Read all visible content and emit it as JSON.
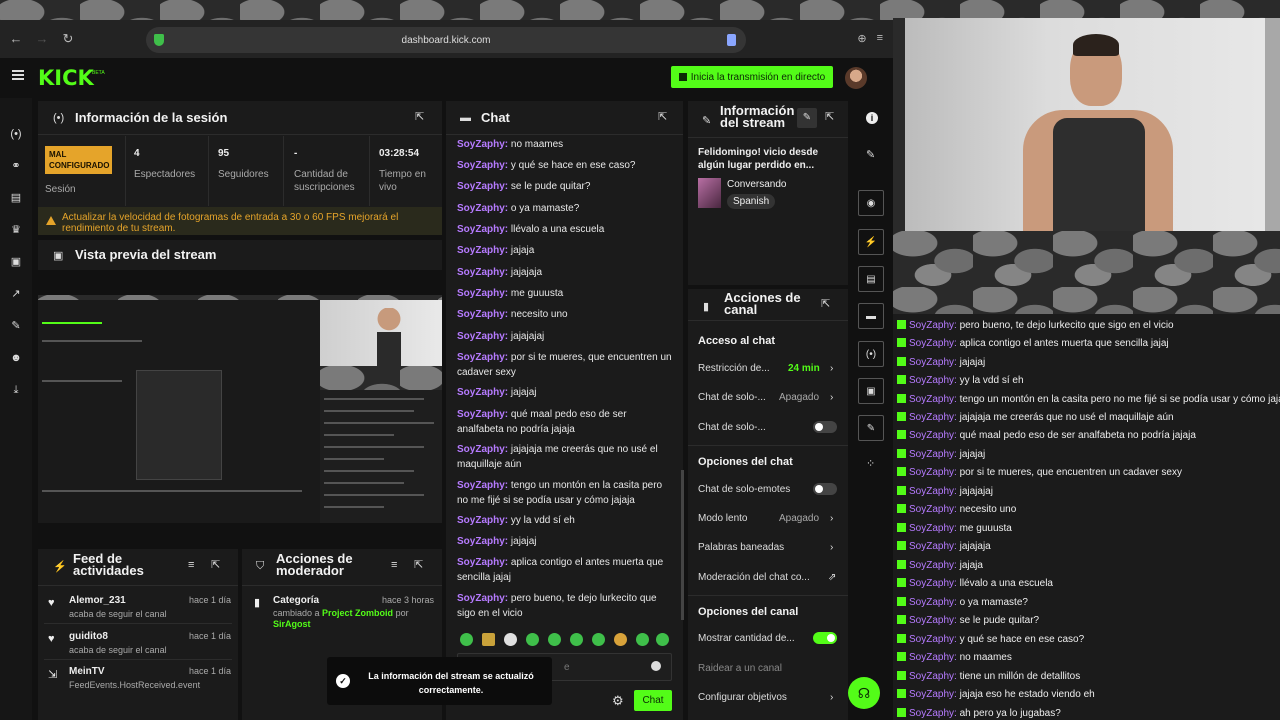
{
  "browser": {
    "url": "dashboard.kick.com"
  },
  "header": {
    "logo": "KICK",
    "beta": "BETA",
    "go_live": "Inicia la transmisión en directo"
  },
  "session": {
    "title": "Información de la sesión",
    "status_badge": "MAL CONFIGURADO",
    "status_label": "Sesión",
    "viewers": "4",
    "viewers_label": "Espectadores",
    "followers": "95",
    "followers_label": "Seguidores",
    "subs": "-",
    "subs_label": "Cantidad de suscripciones",
    "live_time": "03:28:54",
    "live_time_label": "Tiempo en vivo",
    "warning": "Actualizar la velocidad de fotogramas de entrada a 30 o 60 FPS mejorará el rendimiento de tu stream."
  },
  "preview": {
    "title": "Vista previa del stream"
  },
  "feed": {
    "title": "Feed de actividades",
    "items": [
      {
        "name": "Alemor_231",
        "sub": "acaba de seguir el canal",
        "time": "hace 1 día"
      },
      {
        "name": "guidito8",
        "sub": "acaba de seguir el canal",
        "time": "hace 1 día"
      },
      {
        "name": "MeinTV",
        "sub": "FeedEvents.HostReceived.event",
        "time": "hace 1 día"
      }
    ]
  },
  "mod": {
    "title": "Acciones de moderador",
    "item_title": "Categoría",
    "item_time": "hace 3 horas",
    "item_pre": "cambiado a",
    "item_game": "Project Zomboid",
    "item_by": "por",
    "item_user": "SirAgost"
  },
  "chat": {
    "title": "Chat",
    "user": "SoyZaphy:",
    "messages": [
      "no maames",
      "y qué se hace en ese caso?",
      "se le pude quitar?",
      "o ya mamaste?",
      "llévalo a una escuela",
      "jajaja",
      "jajajaja",
      "me guuusta",
      "necesito uno",
      "jajajajaj",
      "por si te mueres, que encuentren un cadaver sexy",
      "jajajaj",
      "qué maal pedo eso de ser analfabeta no podría jajaja",
      "jajajaja me creerás que no usé el maquillaje aún",
      "tengo un montón en la casita pero no me fijé si se podía usar y cómo jajaja",
      "yy la vdd sí eh",
      "jajajaj",
      "aplica contigo el antes muerta que sencilla jajaj",
      "pero bueno, te dejo lurkecito que sigo en el vicio"
    ],
    "input_placeholder": "e",
    "send_label": "Chat"
  },
  "toast": {
    "text": "La información del stream se actualizó correctamente."
  },
  "stream_info": {
    "title": "Información del stream",
    "stream_title": "Felidomingo! vicio desde algún lugar perdido en...",
    "category": "Conversando",
    "language": "Spanish"
  },
  "channel_actions": {
    "title": "Acciones de canal",
    "access_title": "Acceso al chat",
    "restriction_label": "Restricción de...",
    "restriction_value": "24 min",
    "solo_label_1": "Chat de solo-...",
    "solo_value_1": "Apagado",
    "solo_label_2": "Chat de solo-...",
    "chat_options_title": "Opciones del chat",
    "emotes_label": "Chat de solo-emotes",
    "slow_label": "Modo lento",
    "slow_value": "Apagado",
    "banned_label": "Palabras baneadas",
    "moderation_label": "Moderación del chat co...",
    "channel_options_title": "Opciones del canal",
    "show_count_label": "Mostrar cantidad de...",
    "raid_label": "Raidear a un canal",
    "goals_label": "Configurar objetivos"
  },
  "side_chat": {
    "user": "SoyZaphy:",
    "messages": [
      "pero bueno, te dejo lurkecito que sigo en el vicio",
      "aplica contigo el antes muerta que sencilla jajaj",
      "jajajaj",
      "yy la vdd sí eh",
      "tengo un montón en la casita pero no me fijé si se podía usar y cómo jaja",
      "jajajaja me creerás que no usé el maquillaje aún",
      "qué maal pedo eso de ser analfabeta no podría jajaja",
      "jajajaj",
      "por si te mueres, que encuentren un cadaver sexy",
      "jajajajaj",
      "necesito uno",
      "me guuusta",
      "jajajaja",
      "jajaja",
      "llévalo a una escuela",
      "o ya mamaste?",
      "se le pude quitar?",
      "y qué se hace en ese caso?",
      "no maames",
      "tiene un millón de detallitos",
      "jajaja eso he estado viendo eh",
      "ah pero ya lo jugabas?"
    ]
  },
  "colors": {
    "brand": "#53fc18",
    "username": "#b67bff",
    "warning": "#e5a42a"
  }
}
